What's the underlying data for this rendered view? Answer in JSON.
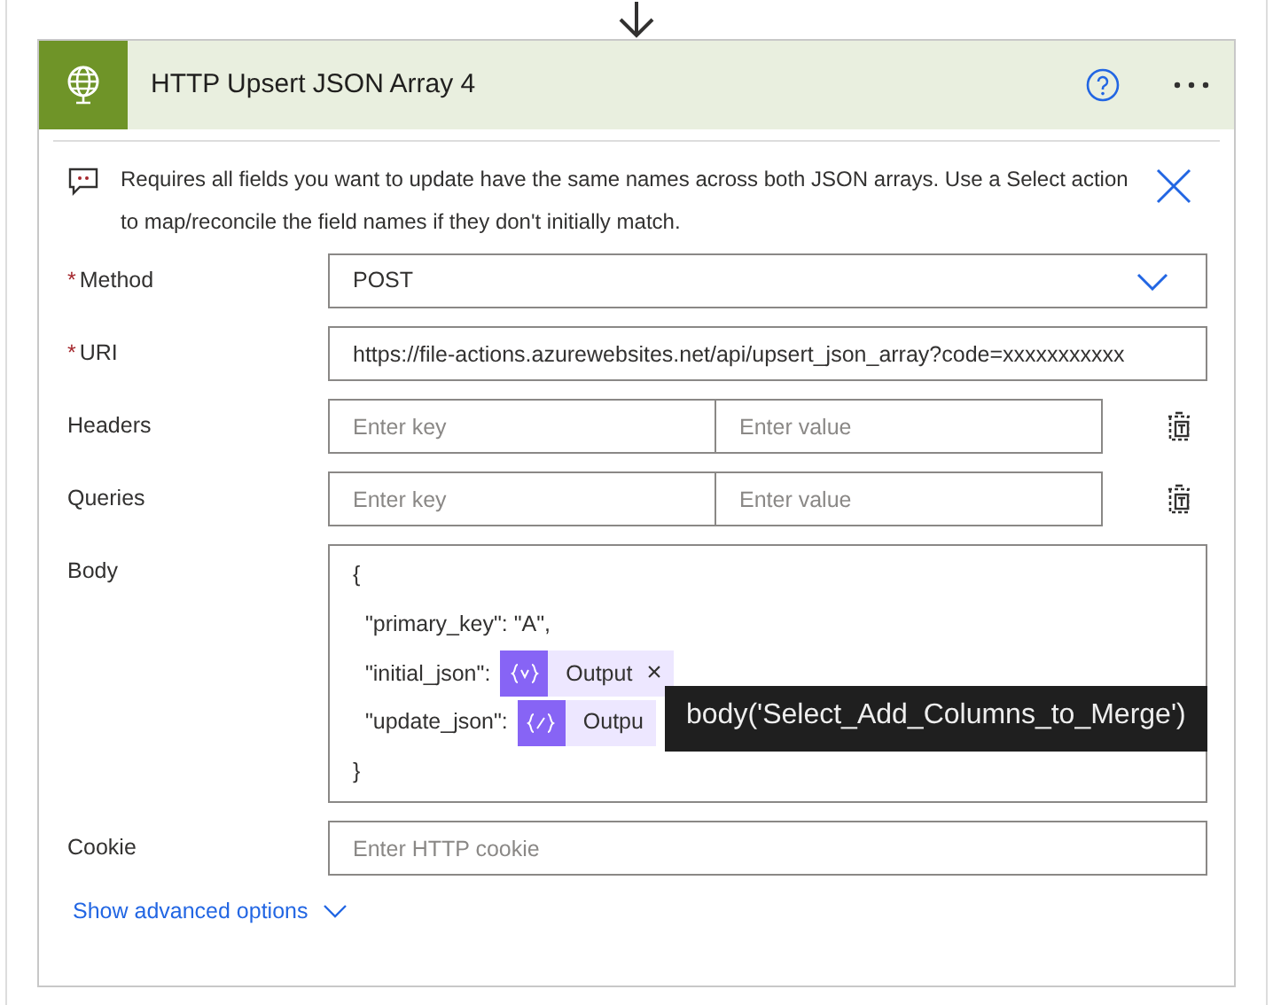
{
  "action": {
    "title": "HTTP Upsert JSON Array 4"
  },
  "info": {
    "text": "Requires all fields you want to update have the same names across both JSON arrays. Use a Select action to map/reconcile the field names if they don't initially match."
  },
  "fields": [
    {
      "kind": "dropdown",
      "label": "Method",
      "required_mark": "*",
      "value": "POST"
    },
    {
      "kind": "text",
      "label": "URI",
      "required_mark": "*",
      "value": "https://file-actions.azurewebsites.net/api/upsert_json_array?code=xxxxxxxxxxx"
    },
    {
      "kind": "keyvalue",
      "label": "Headers",
      "key_placeholder": "Enter key",
      "value_placeholder": "Enter value"
    },
    {
      "kind": "keyvalue",
      "label": "Queries",
      "key_placeholder": "Enter key",
      "value_placeholder": "Enter value"
    },
    {
      "kind": "body",
      "label": "Body",
      "lines": [
        [
          {
            "kind": "text",
            "text": "{"
          }
        ],
        [
          {
            "kind": "text",
            "text": "  \"primary_key\": \"A\","
          }
        ],
        [
          {
            "kind": "text",
            "text": "  \"initial_json\": "
          },
          {
            "kind": "variable-token",
            "text": "Output",
            "remove": "×"
          }
        ],
        [
          {
            "kind": "text",
            "text": "  \"update_json\": "
          },
          {
            "kind": "expression-token",
            "text": "Outpu"
          }
        ],
        [
          {
            "kind": "text",
            "text": "}"
          }
        ]
      ]
    },
    {
      "kind": "text",
      "label": "Cookie",
      "placeholder": "Enter HTTP cookie"
    }
  ],
  "advanced_link": "Show advanced options",
  "tooltip": "body('Select_Add_Columns_to_Merge')"
}
